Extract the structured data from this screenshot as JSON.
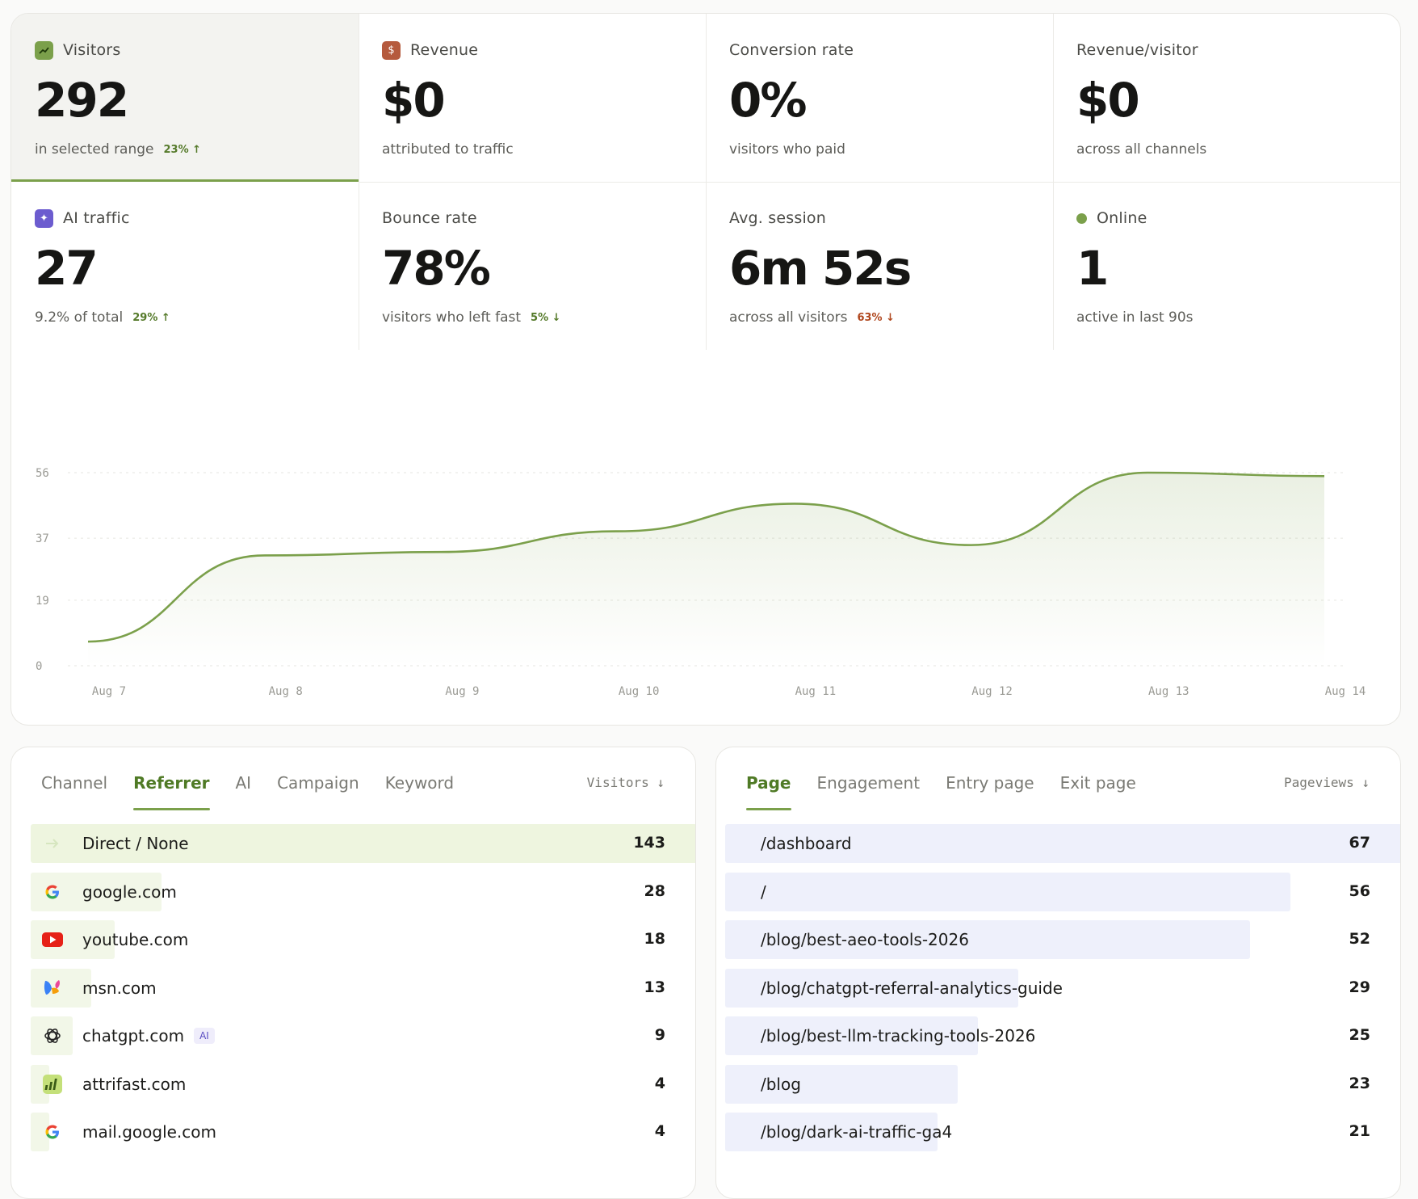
{
  "stats": [
    {
      "label": "Visitors",
      "value": "292",
      "sub": "in selected range",
      "delta": "23%",
      "delta_dir": "up",
      "icon": "trend-up-icon",
      "selected": true
    },
    {
      "label": "Revenue",
      "value": "$0",
      "sub": "attributed to traffic",
      "icon": "dollar-icon"
    },
    {
      "label": "Conversion rate",
      "value": "0%",
      "sub": "visitors who paid"
    },
    {
      "label": "Revenue/visitor",
      "value": "$0",
      "sub": "across all channels"
    },
    {
      "label": "AI traffic",
      "value": "27",
      "sub": "9.2% of total",
      "delta": "29%",
      "delta_dir": "up",
      "icon": "sparkle-icon"
    },
    {
      "label": "Bounce rate",
      "value": "78%",
      "sub": "visitors who left fast",
      "delta": "5%",
      "delta_dir": "down_good"
    },
    {
      "label": "Avg. session",
      "value": "6m 52s",
      "sub": "across all visitors",
      "delta": "63%",
      "delta_dir": "down_bad"
    },
    {
      "label": "Online",
      "value": "1",
      "sub": "active in last 90s",
      "icon": "online-dot-icon"
    }
  ],
  "chart_data": {
    "type": "area",
    "x": [
      "Aug 7",
      "Aug 8",
      "Aug 9",
      "Aug 10",
      "Aug 11",
      "Aug 12",
      "Aug 13",
      "Aug 14"
    ],
    "series": [
      {
        "values": [
          7,
          32,
          33,
          39,
          47,
          35,
          56,
          55
        ]
      }
    ],
    "y_ticks": [
      0,
      19,
      37,
      56
    ],
    "ylim": [
      0,
      56
    ],
    "grid": true,
    "color": "#7ba04b"
  },
  "left_panel": {
    "tabs": [
      "Channel",
      "Referrer",
      "AI",
      "Campaign",
      "Keyword"
    ],
    "active_tab": 1,
    "sort_label": "Visitors ↓",
    "max": 143,
    "rows": [
      {
        "name": "Direct / None",
        "value": 143,
        "icon": "arrow-right-icon"
      },
      {
        "name": "google.com",
        "value": 28,
        "icon": "google-icon"
      },
      {
        "name": "youtube.com",
        "value": 18,
        "icon": "youtube-icon"
      },
      {
        "name": "msn.com",
        "value": 13,
        "icon": "msn-icon"
      },
      {
        "name": "chatgpt.com",
        "value": 9,
        "icon": "chatgpt-icon",
        "badge": "AI"
      },
      {
        "name": "attrifast.com",
        "value": 4,
        "icon": "attrifast-icon"
      },
      {
        "name": "mail.google.com",
        "value": 4,
        "icon": "google-icon"
      }
    ]
  },
  "right_panel": {
    "tabs": [
      "Page",
      "Engagement",
      "Entry page",
      "Exit page"
    ],
    "active_tab": 0,
    "sort_label": "Pageviews ↓",
    "max": 67,
    "rows": [
      {
        "name": "/dashboard",
        "value": 67
      },
      {
        "name": "/",
        "value": 56
      },
      {
        "name": "/blog/best-aeo-tools-2026",
        "value": 52
      },
      {
        "name": "/blog/chatgpt-referral-analytics-guide",
        "value": 29
      },
      {
        "name": "/blog/best-llm-tracking-tools-2026",
        "value": 25
      },
      {
        "name": "/blog",
        "value": 23
      },
      {
        "name": "/blog/dark-ai-traffic-ga4",
        "value": 21
      }
    ]
  }
}
